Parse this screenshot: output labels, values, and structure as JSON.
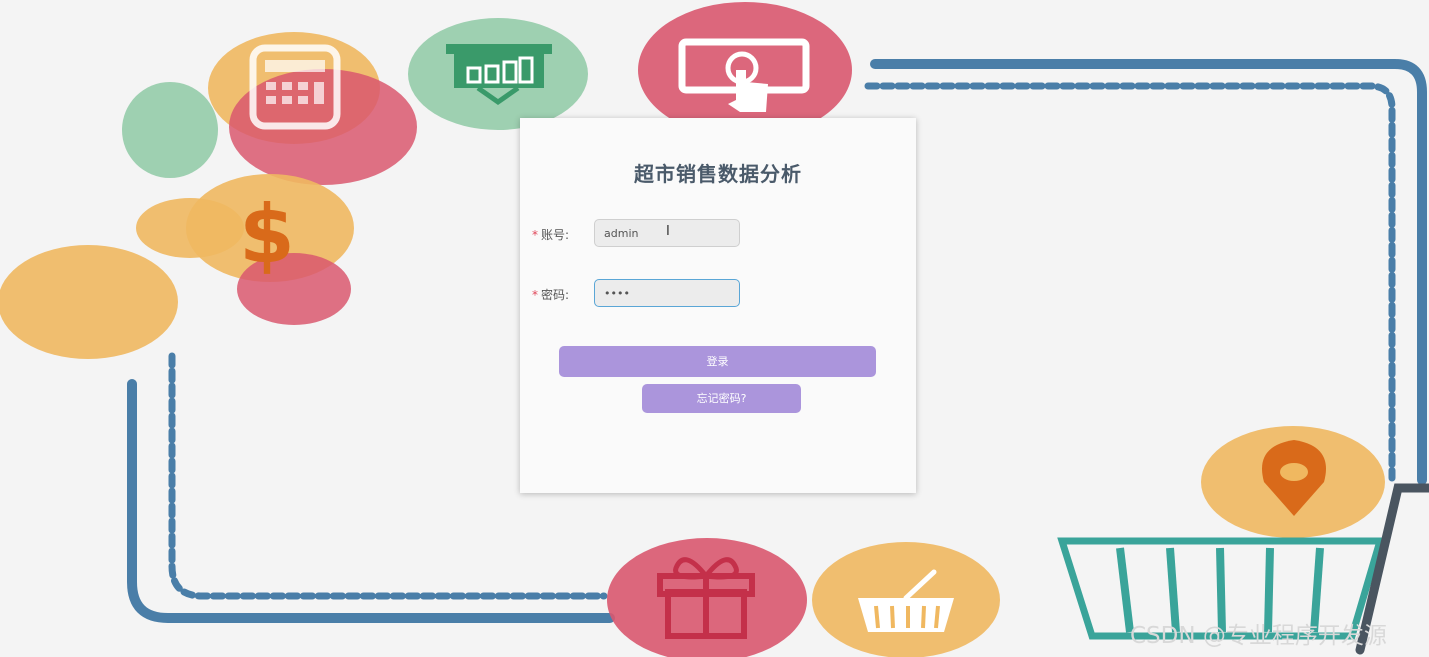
{
  "login": {
    "title": "超市销售数据分析",
    "account_label": "账号:",
    "account_value": "admin",
    "password_label": "密码:",
    "password_value": "••••",
    "required_mark": "*",
    "login_button": "登录",
    "forgot_button": "忘记密码?"
  },
  "watermark": "CSDN @专业程序开发源",
  "icons": [
    "calculator-icon",
    "presentation-chart-icon",
    "touch-screen-icon",
    "dollar-icon",
    "gift-icon",
    "basket-icon",
    "map-pin-icon",
    "shopping-cart-icon"
  ],
  "colors": {
    "orange": "#f0b860",
    "pink": "#d9586f",
    "green": "#8ec9a5",
    "blue": "#4a7ea8",
    "teal": "#3aa49a",
    "button": "#ab95dc",
    "title": "#4a5a6a"
  }
}
